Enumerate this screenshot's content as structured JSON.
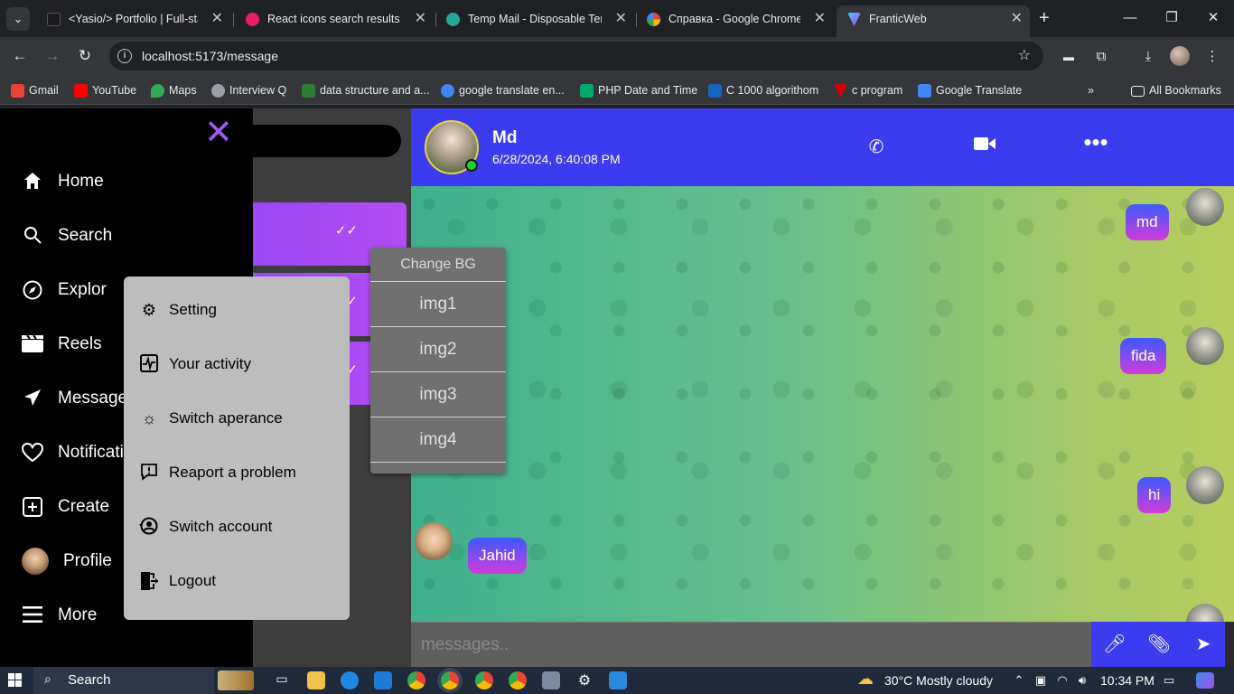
{
  "browser": {
    "tabs": [
      {
        "title": "<Yasio/> Portfolio | Full-stac",
        "favicon_color": "#1a1a1a"
      },
      {
        "title": "React icons search results",
        "favicon_color": "#e91e63"
      },
      {
        "title": "Temp Mail - Disposable Tem",
        "favicon_color": "#26a69a"
      },
      {
        "title": "Справка - Google Chrome",
        "favicon_color": "#4285f4"
      },
      {
        "title": "FranticWeb",
        "favicon_color": "#a259f5"
      }
    ],
    "url": "localhost:5173/message",
    "bookmarks": [
      {
        "label": "Gmail",
        "color": "#ea4335"
      },
      {
        "label": "YouTube",
        "color": "#ff0000"
      },
      {
        "label": "Maps",
        "color": "#34a853"
      },
      {
        "label": "Interview Q",
        "color": "#9aa0a6"
      },
      {
        "label": "data structure and a...",
        "color": "#2e7d32"
      },
      {
        "label": "google translate en...",
        "color": "#4285f4"
      },
      {
        "label": "PHP Date and Time",
        "color": "#04aa6d"
      },
      {
        "label": "C 1000  algorithom",
        "color": "#1565c0"
      },
      {
        "label": "c program",
        "color": "#d50000"
      },
      {
        "label": "Google Translate",
        "color": "#4285f4"
      }
    ],
    "all_bookmarks": "All Bookmarks"
  },
  "sidebar": {
    "items": [
      {
        "label": "Home",
        "icon": "home-icon"
      },
      {
        "label": "Search",
        "icon": "search-icon"
      },
      {
        "label": "Explor",
        "icon": "compass-icon"
      },
      {
        "label": "Reels",
        "icon": "clapperboard-icon"
      },
      {
        "label": "Message",
        "icon": "send-icon"
      },
      {
        "label": "Notificati",
        "icon": "heart-icon"
      },
      {
        "label": "Create",
        "icon": "plus-square-icon"
      },
      {
        "label": "Profile",
        "icon": "avatar"
      },
      {
        "label": "More",
        "icon": "hamburger-icon"
      }
    ]
  },
  "more_menu": {
    "items": [
      {
        "label": "Setting",
        "icon": "gear-icon"
      },
      {
        "label": "Your activity",
        "icon": "activity-icon"
      },
      {
        "label": "Switch aperance",
        "icon": "brightness-icon"
      },
      {
        "label": "Reaport a problem",
        "icon": "report-icon"
      },
      {
        "label": "Switch account",
        "icon": "switch-account-icon"
      },
      {
        "label": "Logout",
        "icon": "logout-icon"
      }
    ]
  },
  "bg_menu": {
    "title": "Change BG",
    "options": [
      "img1",
      "img2",
      "img3",
      "img4"
    ]
  },
  "chat": {
    "name": "Md",
    "datetime": "6/28/2024, 6:40:08 PM",
    "messages": [
      {
        "text": "md",
        "side": "right"
      },
      {
        "text": "fida",
        "side": "right"
      },
      {
        "text": "hi",
        "side": "right"
      },
      {
        "text": "Jahid",
        "side": "left"
      }
    ],
    "input_placeholder": "messages.."
  },
  "taskbar": {
    "search_label": "Search",
    "weather": "30°C  Mostly cloudy",
    "time": "10:34 PM"
  }
}
